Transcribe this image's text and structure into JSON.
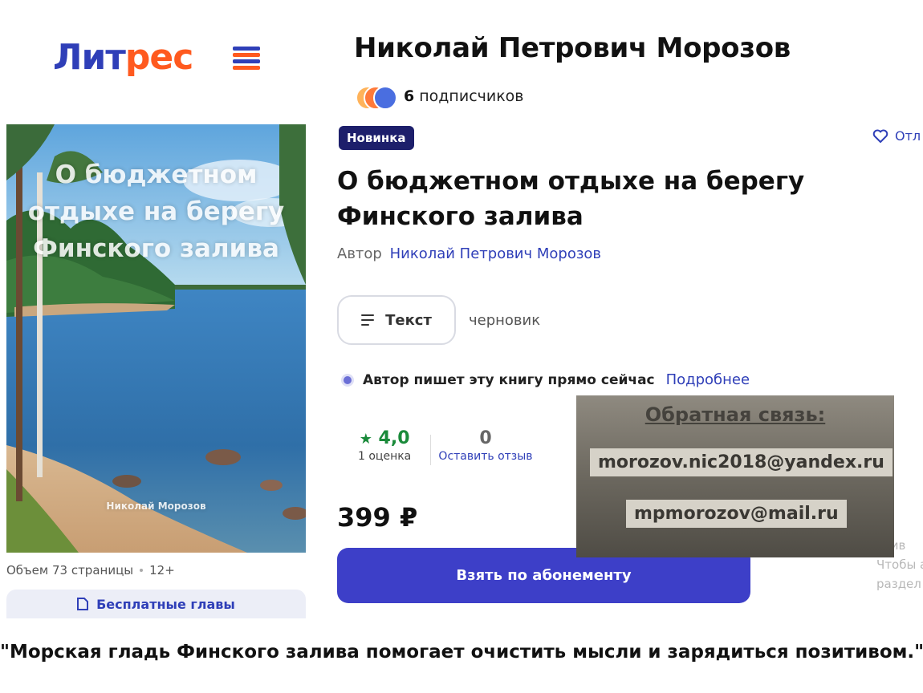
{
  "logo": {
    "part1": "Лит",
    "part2": "рес"
  },
  "author_header": {
    "name": "Николай Петрович Морозов",
    "subscribers_count": "6",
    "subscribers_label": "подписчиков"
  },
  "cover": {
    "title_lines": [
      "О бюджетном",
      "отдыхе на берегу",
      "Финского залива"
    ],
    "author": "Николай Морозов"
  },
  "book": {
    "badge": "Новинка",
    "postpone_label": "Отл",
    "title": "О бюджетном отдыхе на берегу Финского залива",
    "author_label": "Автор",
    "author_link": "Николай Петрович Морозов",
    "format_label": "Текст",
    "draft_label": "черновик",
    "writing_text": "Автор пишет эту книгу прямо сейчас",
    "writing_more": "Подробнее",
    "volume": "Объем 73 страницы",
    "age": "12+",
    "free_chapters": "Бесплатные главы"
  },
  "rating": {
    "value": "4,0",
    "star": "★",
    "count_label": "1 оценка"
  },
  "reviews": {
    "value": "0",
    "link": "Оставить отзыв"
  },
  "price": "399 ₽",
  "subscribe_button": "Взять по абонементу",
  "right_fade": [
    "ктив",
    "Чтобы а",
    "раздел"
  ],
  "feedback": {
    "title": "Обратная связь:",
    "emails": [
      "morozov.nic2018@yandex.ru",
      "mpmorozov@mail.ru"
    ]
  },
  "quote": "\"Морская гладь Финского залива помогает очистить мысли и зарядиться позитивом.\"",
  "colors": {
    "brand_blue": "#2f3fb8",
    "brand_orange": "#ff5a1f",
    "button": "#3d3fc8",
    "badge": "#1d1f6b",
    "rating_green": "#1a8a3a"
  }
}
